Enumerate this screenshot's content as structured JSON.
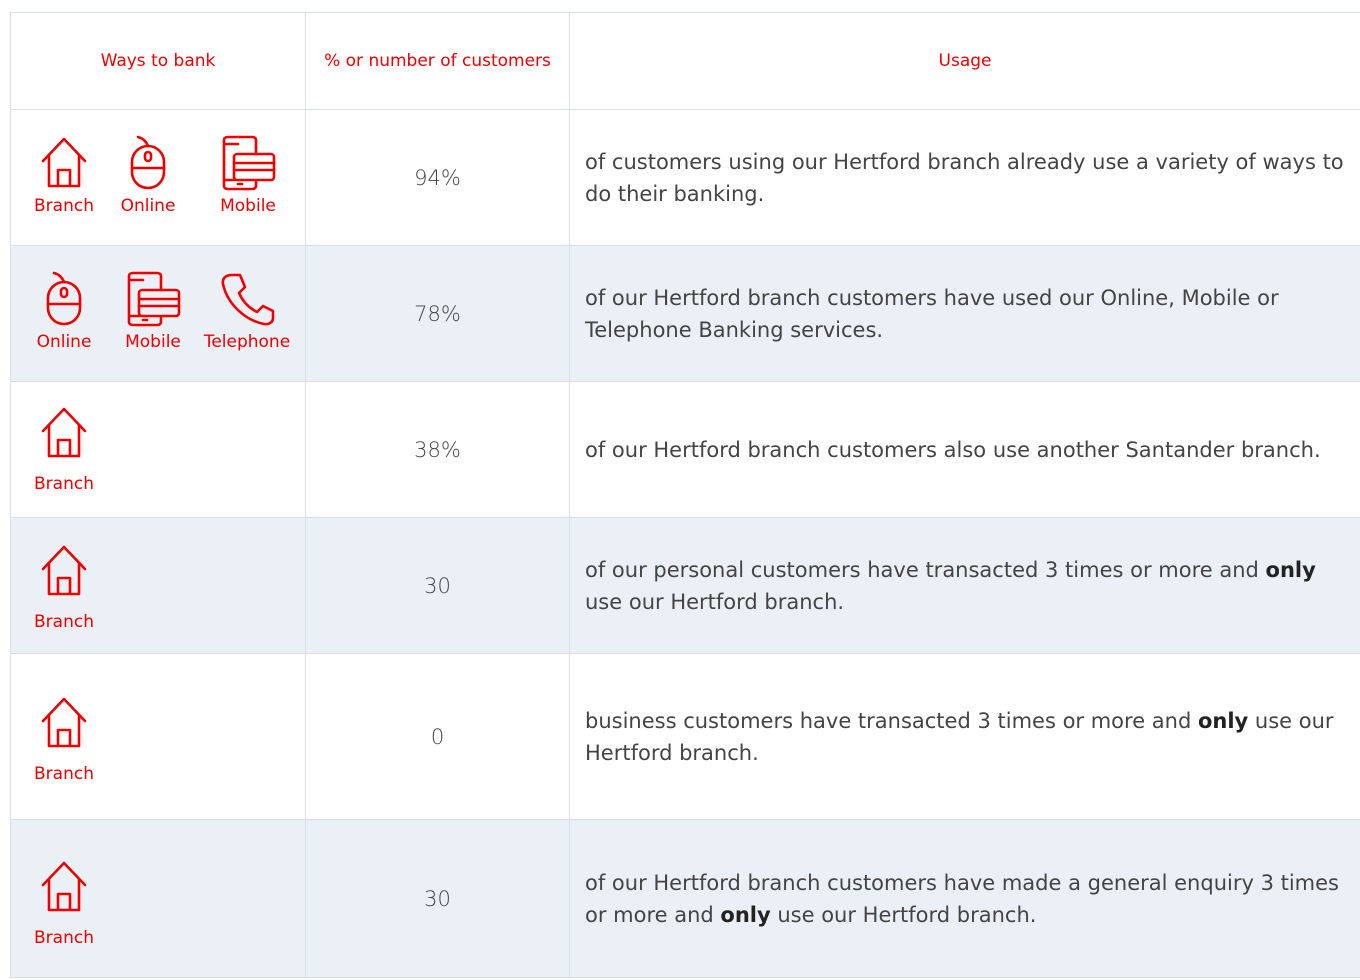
{
  "header": {
    "ways": "Ways to bank",
    "percent": "% or number of customers",
    "usage": "Usage"
  },
  "rows": [
    {
      "icons": [
        {
          "icon": "house-icon",
          "label": "Branch"
        },
        {
          "icon": "mouse-icon",
          "label": "Online"
        },
        {
          "icon": "mobile-card-icon",
          "label": "Mobile"
        }
      ],
      "value": "94%",
      "usage": "of customers using our Hertford branch already use a variety of ways to do their banking."
    },
    {
      "icons": [
        {
          "icon": "mouse-icon",
          "label": "Online"
        },
        {
          "icon": "mobile-card-icon",
          "label": "Mobile"
        },
        {
          "icon": "phone-icon",
          "label": "Telephone"
        }
      ],
      "value": "78%",
      "usage": "of our Hertford branch customers have used our Online, Mobile or Telephone Banking services."
    },
    {
      "icons": [
        {
          "icon": "house-icon",
          "label": "Branch"
        }
      ],
      "value": "38%",
      "usage": "of our Hertford branch customers also use another Santander branch."
    },
    {
      "icons": [
        {
          "icon": "house-icon",
          "label": "Branch"
        }
      ],
      "value": "30",
      "usage_before": "of our personal customers have transacted 3 times or more and ",
      "usage_bold": "only",
      "usage_after": " use our Hertford branch."
    },
    {
      "icons": [
        {
          "icon": "house-icon",
          "label": "Branch"
        }
      ],
      "value": "0",
      "usage_before": "business customers have transacted 3 times or more and ",
      "usage_bold": "only",
      "usage_after": " use our Hertford branch."
    },
    {
      "icons": [
        {
          "icon": "house-icon",
          "label": "Branch"
        }
      ],
      "value": "30",
      "usage_before": "of our Hertford branch customers have made a general enquiry 3 times or more and ",
      "usage_bold": "only",
      "usage_after": " use our Hertford branch."
    }
  ],
  "colors": {
    "brand_red": "#ec0000",
    "row_shade": "#eaf0f6",
    "grid_line": "#d6e0ea",
    "body_text": "#444444"
  }
}
